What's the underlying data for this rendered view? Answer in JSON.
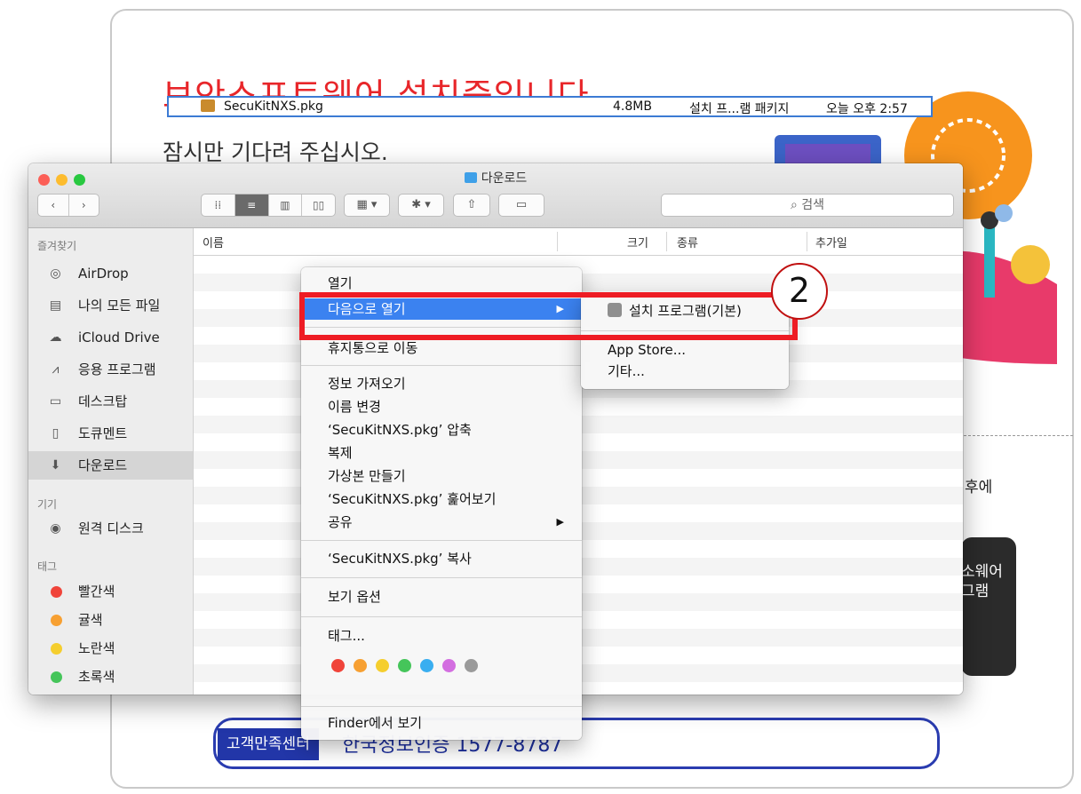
{
  "background": {
    "title": "보안소프트웨어 설치중입니다.",
    "subtitle": "잠시만 기다려 주십시오.",
    "fragment_right": "후에",
    "fragment_dark_line1": "소웨어",
    "fragment_dark_line2": "그램",
    "support_label": "고객만족센터",
    "support_text": "한국정보인증 1577-8787"
  },
  "finder": {
    "window_title": "다운로드",
    "search_placeholder": "검색",
    "sidebar": {
      "favorites_header": "즐겨찾기",
      "favorites": [
        {
          "label": "AirDrop",
          "icon": "airdrop-icon",
          "glyph": "◎"
        },
        {
          "label": "나의 모든 파일",
          "icon": "all-files-icon",
          "glyph": "▤"
        },
        {
          "label": "iCloud Drive",
          "icon": "cloud-icon",
          "glyph": "☁"
        },
        {
          "label": "응용 프로그램",
          "icon": "applications-icon",
          "glyph": "⩘"
        },
        {
          "label": "데스크탑",
          "icon": "desktop-icon",
          "glyph": "▭"
        },
        {
          "label": "도큐멘트",
          "icon": "documents-icon",
          "glyph": "▯"
        },
        {
          "label": "다운로드",
          "icon": "downloads-icon",
          "glyph": "⬇"
        }
      ],
      "devices_header": "기기",
      "devices": [
        {
          "label": "원격 디스크",
          "icon": "disc-icon",
          "glyph": "◉"
        }
      ],
      "tags_header": "태그",
      "tags": [
        {
          "label": "빨간색",
          "color": "#f0443a"
        },
        {
          "label": "귤색",
          "color": "#f7a032"
        },
        {
          "label": "노란색",
          "color": "#f5ce2e"
        },
        {
          "label": "초록색",
          "color": "#45c55a"
        }
      ]
    },
    "columns": {
      "name": "이름",
      "size": "크기",
      "kind": "종류",
      "date_added": "추가일"
    },
    "file": {
      "name": "SecuKitNXS.pkg",
      "size": "4.8MB",
      "kind": "설치 프...램 패키지",
      "date_added": "오늘 오후 2:57"
    }
  },
  "context_menu": {
    "open": "열기",
    "open_with": "다음으로 열기",
    "move_to_trash": "휴지통으로 이동",
    "get_info": "정보 가져오기",
    "rename": "이름 변경",
    "compress": "‘SecuKitNXS.pkg’ 압축",
    "duplicate": "복제",
    "make_alias": "가상본 만들기",
    "quick_look": "‘SecuKitNXS.pkg’ 훑어보기",
    "share": "공유",
    "copy": "‘SecuKitNXS.pkg’ 복사",
    "view_options": "보기 옵션",
    "tags": "태그...",
    "tag_colors": [
      "#f0443a",
      "#f7a032",
      "#f5ce2e",
      "#45c55a",
      "#39aef0",
      "#d36ee0",
      "#9a9a9a"
    ],
    "show_in_finder": "Finder에서 보기"
  },
  "submenu": {
    "installer": "설치 프로그램(기본)",
    "app_store": "App Store...",
    "other": "기타..."
  },
  "annotation": {
    "step_number": "2",
    "highlight_color": "#ee1c24"
  }
}
